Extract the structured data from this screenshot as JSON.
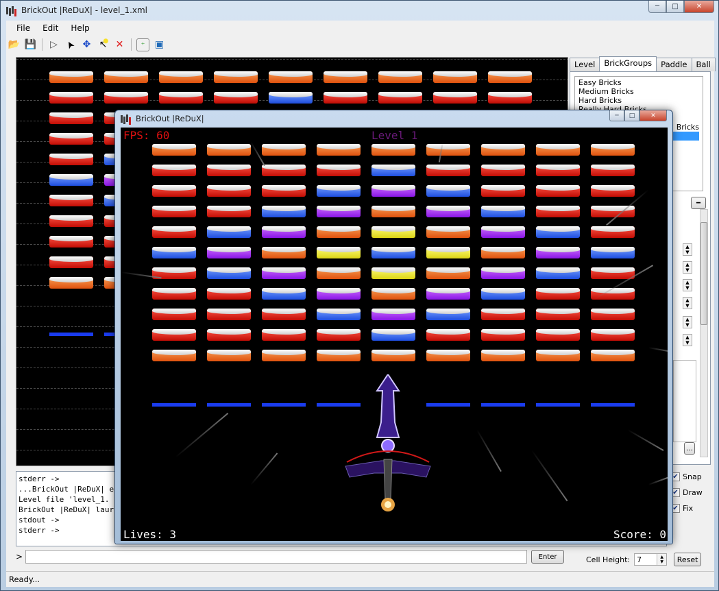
{
  "window": {
    "title": "BrickOut |ReDuX| - level_1.xml",
    "min": "─",
    "max": "□",
    "close": "✕"
  },
  "menu": [
    "File",
    "Edit",
    "Help"
  ],
  "toolbar": {
    "open_icon": "📂",
    "save_icon": "💾",
    "play_icon": "▷",
    "select_icon": "➤",
    "move_icon": "✥",
    "add_icon": "↖",
    "delete_icon": "✕",
    "add_group_icon": "⁺",
    "image_icon": "▣"
  },
  "tabs": [
    "Level",
    "BrickGroups",
    "Paddle",
    "Ball"
  ],
  "brick_groups": [
    "Easy Bricks",
    "Medium Bricks",
    "Hard Bricks",
    "Really Hard Bricks",
    "Bricks"
  ],
  "checkboxes": [
    {
      "label": "Snap",
      "checked": true
    },
    {
      "label": "Draw",
      "checked": true
    },
    {
      "label": "Fix",
      "checked": true
    }
  ],
  "console": {
    "lines": [
      "stderr ->",
      "...BrickOut |ReDuX| e",
      "Level file 'level_1.",
      "BrickOut |ReDuX| laur",
      "stdout ->",
      "stderr ->"
    ]
  },
  "command": {
    "prompt": ">",
    "enter_label": "Enter"
  },
  "cell_height": {
    "label": "Cell Height:",
    "value": "7"
  },
  "reset_label": "Reset",
  "status": "Ready...",
  "game": {
    "title": "BrickOut |ReDuX|",
    "fps": "FPS: 60",
    "level": "Level 1",
    "lives": "Lives: 3",
    "score": "Score: 0",
    "brick_grid": [
      [
        "orange",
        "orange",
        "orange",
        "orange",
        "orange",
        "orange",
        "orange",
        "orange",
        "orange"
      ],
      [
        "red",
        "red",
        "red",
        "red",
        "blue",
        "red",
        "red",
        "red",
        "red"
      ],
      [
        "red",
        "red",
        "red",
        "blue",
        "purple",
        "blue",
        "red",
        "red",
        "red"
      ],
      [
        "red",
        "red",
        "blue",
        "purple",
        "orange",
        "purple",
        "blue",
        "red",
        "red"
      ],
      [
        "red",
        "blue",
        "purple",
        "orange",
        "yellow",
        "orange",
        "purple",
        "blue",
        "red"
      ],
      [
        "blue",
        "purple",
        "orange",
        "yellow",
        "blue",
        "yellow",
        "orange",
        "purple",
        "blue"
      ],
      [
        "red",
        "blue",
        "purple",
        "orange",
        "yellow",
        "orange",
        "purple",
        "blue",
        "red"
      ],
      [
        "red",
        "red",
        "blue",
        "purple",
        "orange",
        "purple",
        "blue",
        "red",
        "red"
      ],
      [
        "red",
        "red",
        "red",
        "blue",
        "purple",
        "blue",
        "red",
        "red",
        "red"
      ],
      [
        "red",
        "red",
        "red",
        "red",
        "blue",
        "red",
        "red",
        "red",
        "red"
      ],
      [
        "orange",
        "orange",
        "orange",
        "orange",
        "orange",
        "orange",
        "orange",
        "orange",
        "orange"
      ]
    ],
    "bars": [
      true,
      true,
      true,
      true,
      false,
      true,
      true,
      true,
      true
    ]
  },
  "colors": {
    "fps": "#e01010",
    "level": "#6a1a7a",
    "hud": "#ffffff",
    "selection": "#3399ff"
  }
}
